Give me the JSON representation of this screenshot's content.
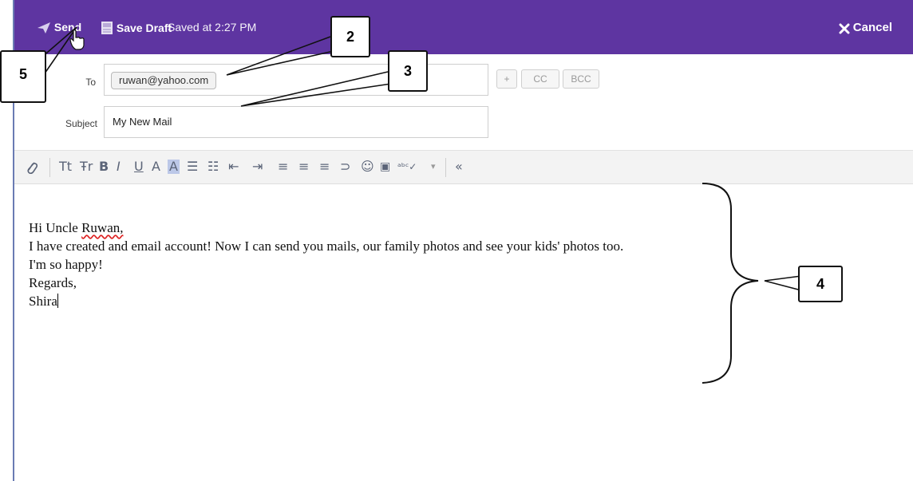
{
  "toolbar_top": {
    "send_label": "Send",
    "save_draft_label": "Save Draft",
    "saved_status": "Saved at 2:27 PM",
    "cancel_label": "Cancel"
  },
  "compose": {
    "to_label": "To",
    "to_recipient": "ruwan@yahoo.com",
    "plus_label": "+",
    "cc_label": "CC",
    "bcc_label": "BCC",
    "subject_label": "Subject",
    "subject_value": "My New Mail"
  },
  "format_tools": [
    {
      "name": "attach-icon",
      "glyph": "🖇"
    },
    {
      "name": "font-size-icon",
      "glyph": "Tt"
    },
    {
      "name": "font-family-icon",
      "glyph": "Ŧr"
    },
    {
      "name": "bold-icon",
      "glyph": "B"
    },
    {
      "name": "italic-icon",
      "glyph": "I"
    },
    {
      "name": "underline-icon",
      "glyph": "U"
    },
    {
      "name": "text-color-icon",
      "glyph": "A"
    },
    {
      "name": "highlight-color-icon",
      "glyph": "A"
    },
    {
      "name": "bullet-list-icon",
      "glyph": "☰"
    },
    {
      "name": "numbered-list-icon",
      "glyph": "☷"
    },
    {
      "name": "outdent-icon",
      "glyph": "⇤"
    },
    {
      "name": "indent-icon",
      "glyph": "⇥"
    },
    {
      "name": "align-left-icon",
      "glyph": "≡"
    },
    {
      "name": "align-center-icon",
      "glyph": "≡"
    },
    {
      "name": "align-right-icon",
      "glyph": "≡"
    },
    {
      "name": "link-icon",
      "glyph": "⊃"
    },
    {
      "name": "emoji-icon",
      "glyph": "☺"
    },
    {
      "name": "insert-image-icon",
      "glyph": "▣"
    },
    {
      "name": "spellcheck-icon",
      "glyph": "ᵃᵇᶜ✓"
    },
    {
      "name": "spellcheck-dropdown-icon",
      "glyph": "▾"
    },
    {
      "name": "collapse-toolbar-icon",
      "glyph": "«"
    }
  ],
  "body_lines": {
    "greeting_pre": "Hi Uncle ",
    "greeting_name": "Ruwan,",
    "line2": "I have created and email account! Now I can send you mails, our family photos and see your kids' photos too.",
    "line3": "I'm so happy!",
    "line4": "Regards,",
    "line5": "Shira"
  },
  "callouts": {
    "c2": "2",
    "c3": "3",
    "c4": "4",
    "c5": "5"
  },
  "colors": {
    "topbar": "#5e35a1",
    "toolbar_bg": "#f3f3f3",
    "tool_icon": "#5b6478"
  }
}
